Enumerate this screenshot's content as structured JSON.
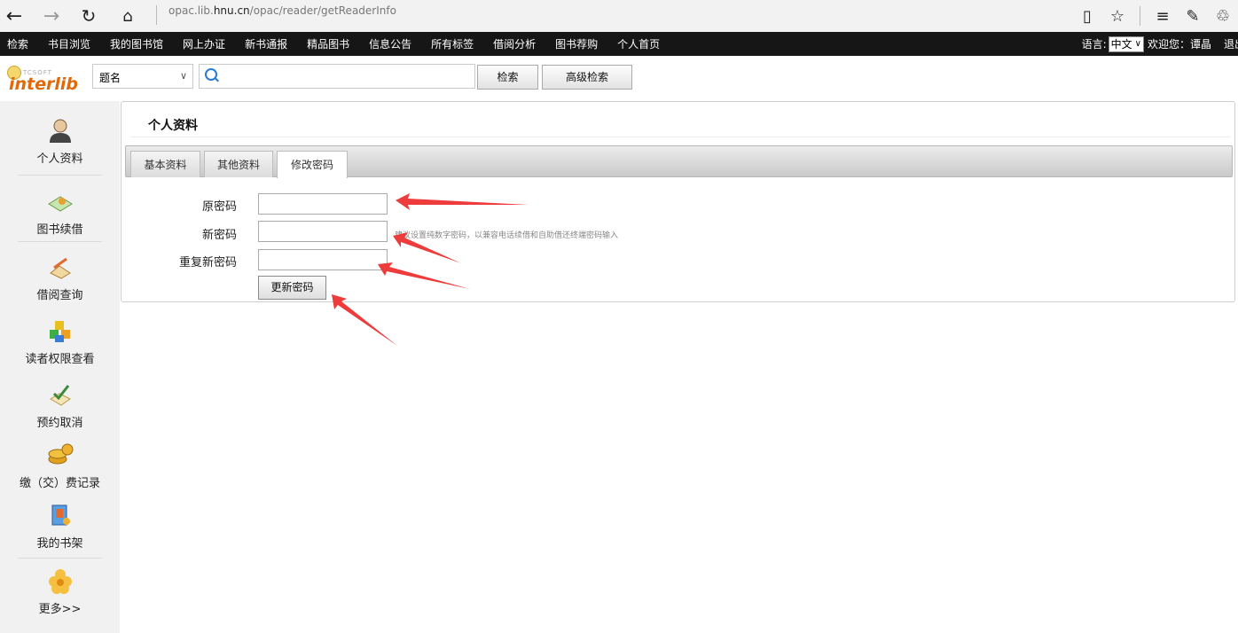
{
  "browser": {
    "address_prefix": "opac.lib.",
    "address_domain": "hnu.cn",
    "address_path": "/opac/reader/getReaderInfo",
    "icons": [
      "back-icon",
      "forward-icon",
      "refresh-icon",
      "home-icon",
      "reading-view-icon",
      "favorite-star-icon",
      "hub-icon",
      "web-note-icon",
      "share-icon"
    ]
  },
  "topnav": {
    "items": [
      "检索",
      "书目浏览",
      "我的图书馆",
      "网上办证",
      "新书通报",
      "精品图书",
      "信息公告",
      "所有标签",
      "借阅分析",
      "图书荐购",
      "个人首页"
    ],
    "lang_label": "语言:",
    "lang_value": "中文",
    "welcome": "欢迎您：谭晶",
    "logout": "退出"
  },
  "logo": {
    "small": "TCSOFT",
    "name": "interlib"
  },
  "search": {
    "field": "题名",
    "query": "",
    "search_btn": "检索",
    "advanced_btn": "高级检索"
  },
  "sidebar": {
    "items": [
      {
        "label": "个人资料",
        "icon": "person-icon"
      },
      {
        "label": "图书续借",
        "icon": "book-renew-icon"
      },
      {
        "label": "借阅查询",
        "icon": "borrow-query-icon"
      },
      {
        "label": "读者权限查看",
        "icon": "permissions-icon"
      },
      {
        "label": "预约取消",
        "icon": "reservation-cancel-icon"
      },
      {
        "label": "缴（交）费记录",
        "icon": "fee-record-icon"
      },
      {
        "label": "我的书架",
        "icon": "bookshelf-icon"
      },
      {
        "label": "更多>>",
        "icon": "more-icon"
      }
    ]
  },
  "panel": {
    "title": "个人资料",
    "tabs": [
      "基本资料",
      "其他资料",
      "修改密码"
    ],
    "active_tab": "修改密码",
    "form": {
      "old_pwd_label": "原密码",
      "new_pwd_label": "新密码",
      "repeat_pwd_label": "重复新密码",
      "hint": "建议设置纯数字密码，以兼容电话续借和自助借还终端密码输入",
      "submit": "更新密码"
    }
  },
  "colors": {
    "nav_bg": "#161616",
    "sidebar_bg": "#f1f1f1",
    "arrow": "#ee3b3b",
    "logo_orange": "#e06a0a"
  }
}
